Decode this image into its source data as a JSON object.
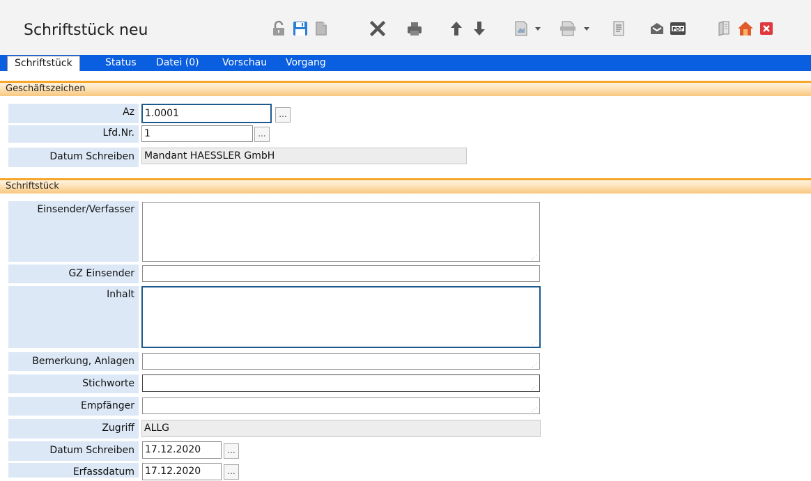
{
  "window": {
    "title": "Schriftstück  neu"
  },
  "toolbar": {
    "icons": [
      "unlock-icon",
      "save-icon",
      "new-document-icon",
      "delete-icon",
      "print-icon",
      "arrow-up-icon",
      "arrow-down-icon",
      "document-dropdown-icon",
      "scan-dropdown-icon",
      "notes-icon",
      "mail-icon",
      "pdf-icon",
      "book-icon",
      "home-icon",
      "close-icon"
    ],
    "pdf_label": "PDF"
  },
  "tabs": [
    "Schriftstück",
    "Status",
    "Datei (0)",
    "Vorschau",
    "Vorgang"
  ],
  "sections": {
    "geschaeftszeichen": "Geschäftszeichen",
    "schriftstueck": "Schriftstück"
  },
  "fields": {
    "az": {
      "label": "Az",
      "value": "1.0001"
    },
    "lfdnr": {
      "label": "Lfd.Nr.",
      "value": "1"
    },
    "datum_mandant": {
      "label": "Datum Schreiben",
      "value": "Mandant HAESSLER GmbH"
    },
    "einsender": {
      "label": "Einsender/Verfasser",
      "value": ""
    },
    "gz_einsender": {
      "label": "GZ Einsender",
      "value": ""
    },
    "inhalt": {
      "label": "Inhalt",
      "value": ""
    },
    "bemerkung": {
      "label": "Bemerkung, Anlagen",
      "value": ""
    },
    "stichworte": {
      "label": "Stichworte",
      "value": ""
    },
    "empfaenger": {
      "label": "Empfänger",
      "value": ""
    },
    "zugriff": {
      "label": "Zugriff",
      "value": "ALLG"
    },
    "datum_schreiben": {
      "label": "Datum Schreiben",
      "value": "17.12.2020"
    },
    "erfassdatum": {
      "label": "Erfassdatum",
      "value": "17.12.2020"
    }
  },
  "lookup_label": "...",
  "colors": {
    "tabbar": "#0a5ee0",
    "section_accent": "#f6a629",
    "label_bg": "#dce8f6",
    "focus_border": "#1c5a8e"
  }
}
